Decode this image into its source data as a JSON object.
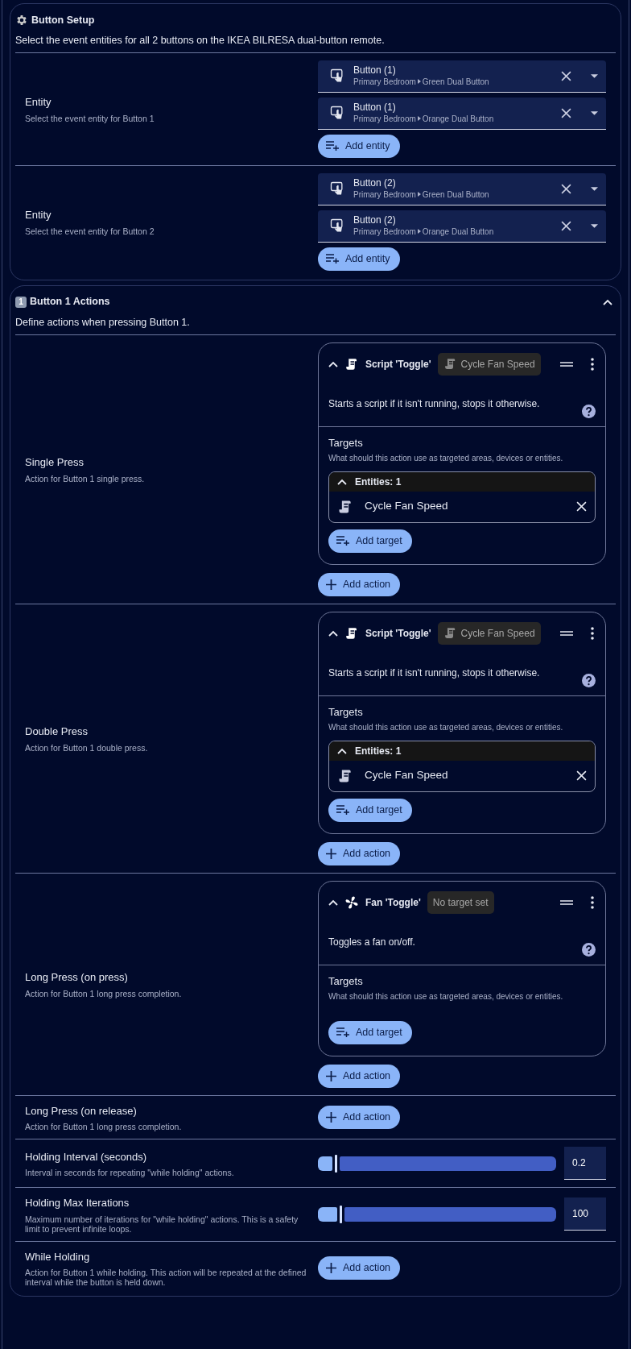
{
  "sections": [
    {
      "kind": "gear",
      "title": "Button Setup",
      "description": "Select the event entities for all 2 buttons on the IKEA BILRESA dual-button remote.",
      "rows": [
        {
          "kind": "entities",
          "label": "Entity",
          "description": "Select the event entity for Button 1",
          "entities": [
            {
              "name": "Button (1)",
              "area": "Primary Bedroom",
              "device": "Green Dual Button"
            },
            {
              "name": "Button (1)",
              "area": "Primary Bedroom",
              "device": "Orange Dual Button"
            }
          ],
          "add_button": "Add entity"
        },
        {
          "kind": "entities",
          "label": "Entity",
          "description": "Select the event entity for Button 2",
          "entities": [
            {
              "name": "Button (2)",
              "area": "Primary Bedroom",
              "device": "Green Dual Button"
            },
            {
              "name": "Button (2)",
              "area": "Primary Bedroom",
              "device": "Orange Dual Button"
            }
          ],
          "add_button": "Add entity"
        }
      ]
    },
    {
      "kind": "keycap",
      "number": "1",
      "title": "Button 1 Actions",
      "expanded": true,
      "description": "Define actions when pressing Button 1.",
      "rows": [
        {
          "kind": "actions",
          "label": "Single Press",
          "description": "Action for Button 1 single press.",
          "actions": [
            {
              "kind": "script",
              "title": "Script 'Toggle'",
              "chip": {
                "kind": "script",
                "label": "Cycle Fan Speed"
              },
              "expanded": true,
              "description": "Starts a script if it isn't running, stops it otherwise.",
              "targets_label": "Targets",
              "targets_hint": "What should this action use as targeted areas, devices or entities.",
              "target_group": {
                "header": "Entities: 1",
                "expanded": true,
                "items": [
                  {
                    "kind": "script",
                    "name": "Cycle Fan Speed"
                  }
                ]
              },
              "add_target": "Add target"
            }
          ],
          "add_button": "Add action"
        },
        {
          "kind": "actions",
          "label": "Double Press",
          "description": "Action for Button 1 double press.",
          "actions": [
            {
              "kind": "script",
              "title": "Script 'Toggle'",
              "chip": {
                "kind": "script",
                "label": "Cycle Fan Speed"
              },
              "expanded": true,
              "description": "Starts a script if it isn't running, stops it otherwise.",
              "targets_label": "Targets",
              "targets_hint": "What should this action use as targeted areas, devices or entities.",
              "target_group": {
                "header": "Entities: 1",
                "expanded": true,
                "items": [
                  {
                    "kind": "script",
                    "name": "Cycle Fan Speed"
                  }
                ]
              },
              "add_target": "Add target"
            }
          ],
          "add_button": "Add action"
        },
        {
          "kind": "actions",
          "label": "Long Press (on press)",
          "description": "Action for Button 1 long press completion.",
          "actions": [
            {
              "kind": "fan",
              "title": "Fan 'Toggle'",
              "chip": {
                "kind": "none",
                "label": "No target set"
              },
              "expanded": true,
              "description": "Toggles a fan on/off.",
              "targets_label": "Targets",
              "targets_hint": "What should this action use as targeted areas, devices or entities.",
              "add_target": "Add target"
            }
          ],
          "add_button": "Add action"
        },
        {
          "kind": "actions",
          "label": "Long Press (on release)",
          "description": "Action for Button 1 long press completion.",
          "add_button": "Add action"
        },
        {
          "kind": "slider",
          "label": "Holding Interval (seconds)",
          "description": "Interval in seconds for repeating \"while holding\" actions.",
          "level": 0.06,
          "value": "0.2"
        },
        {
          "kind": "slider",
          "label": "Holding Max Iterations",
          "description": "Maximum number of iterations for \"while holding\" actions. This is a safety limit to prevent infinite loops.",
          "level": 0.08,
          "value": "100"
        },
        {
          "kind": "actions",
          "label": "While Holding",
          "description": "Action for Button 1 while holding. This action will be repeated at the defined interval while the button is held down.",
          "add_button": "Add action"
        }
      ]
    }
  ]
}
